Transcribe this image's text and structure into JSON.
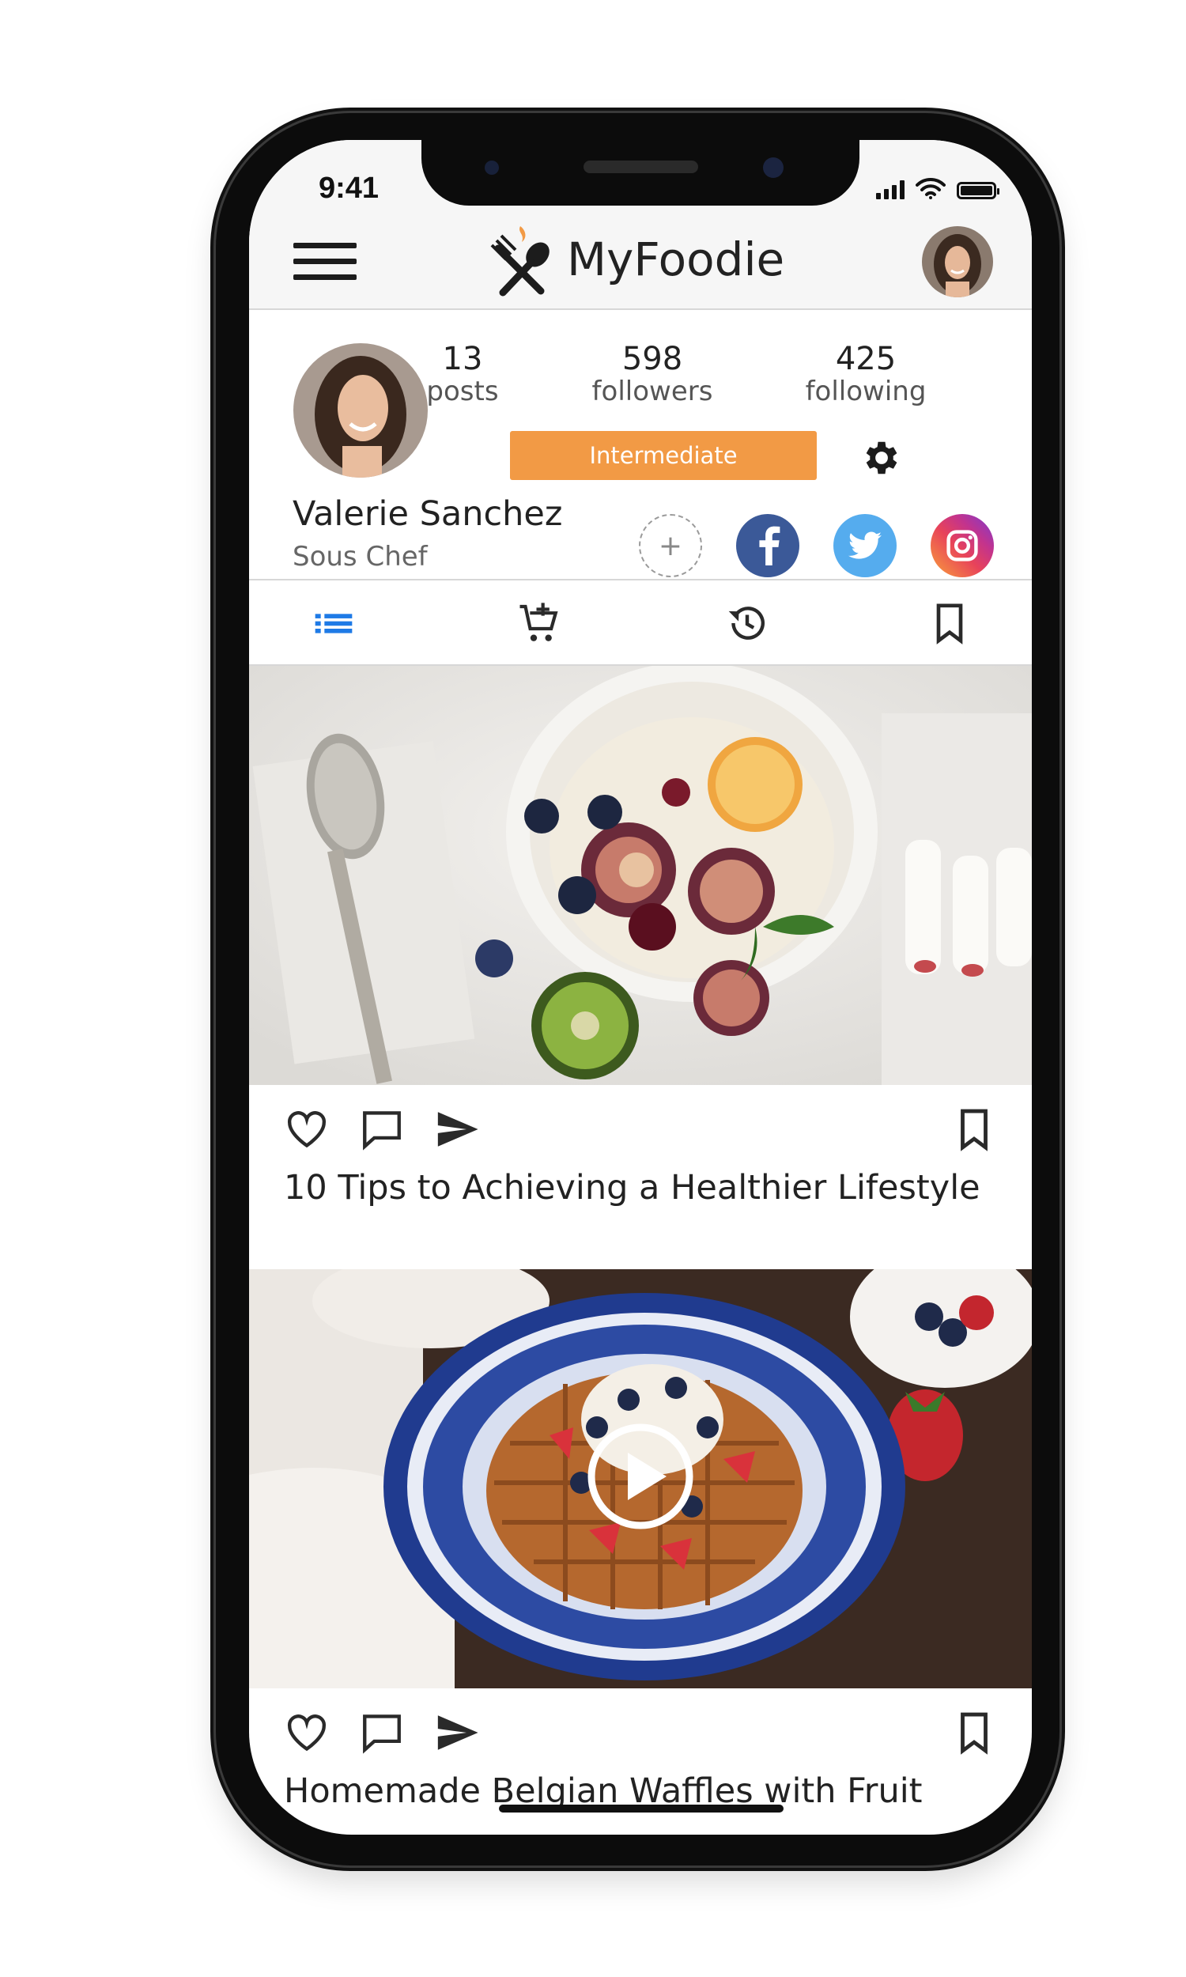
{
  "status_bar": {
    "time": "9:41"
  },
  "app_bar": {
    "brand": "MyFoodie"
  },
  "profile": {
    "name": "Valerie Sanchez",
    "role": "Sous Chef",
    "level": "Intermediate",
    "stats": [
      {
        "value": "13",
        "label": "posts"
      },
      {
        "value": "598",
        "label": "followers"
      },
      {
        "value": "425",
        "label": "following"
      }
    ],
    "social": [
      "add-social",
      "facebook",
      "twitter",
      "instagram"
    ]
  },
  "tabs": [
    {
      "name": "list",
      "active": true
    },
    {
      "name": "add-to-cart",
      "active": false
    },
    {
      "name": "history",
      "active": false
    },
    {
      "name": "bookmarks",
      "active": false
    }
  ],
  "posts": [
    {
      "caption": "10 Tips to Achieving a Healthier Lifestyle",
      "media": "photo"
    },
    {
      "caption": "Homemade Belgian Waffles with Fruit",
      "media": "video"
    }
  ],
  "colors": {
    "accent": "#f29a45",
    "active_tab": "#1e7ae6",
    "facebook": "#3b5998",
    "twitter": "#55acee"
  }
}
